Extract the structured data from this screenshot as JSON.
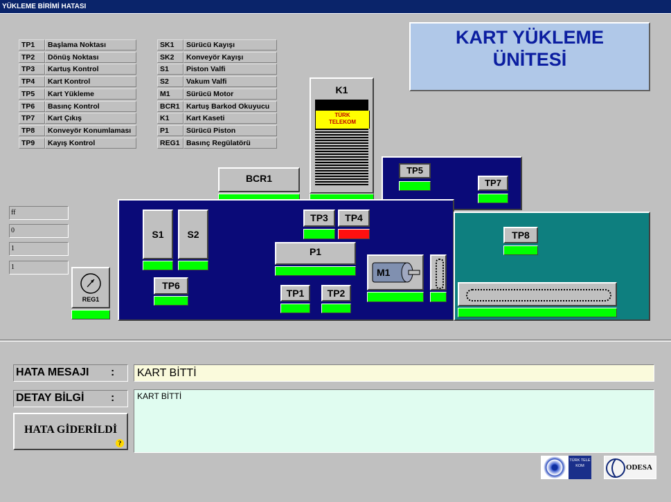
{
  "window_title": "YÜKLEME BİRİMİ HATASI",
  "header_title_line1": "KART YÜKLEME",
  "header_title_line2": "ÜNİTESİ",
  "legend_left": [
    {
      "code": "TP1",
      "desc": "Başlama Noktası"
    },
    {
      "code": "TP2",
      "desc": "Dönüş Noktası"
    },
    {
      "code": "TP3",
      "desc": "Kartuş Kontrol"
    },
    {
      "code": "TP4",
      "desc": "Kart Kontrol"
    },
    {
      "code": "TP5",
      "desc": "Kart Yükleme"
    },
    {
      "code": "TP6",
      "desc": "Basınç Kontrol"
    },
    {
      "code": "TP7",
      "desc": "Kart Çıkış"
    },
    {
      "code": "TP8",
      "desc": "Konveyör Konumlaması"
    },
    {
      "code": "TP9",
      "desc": "Kayış Kontrol"
    }
  ],
  "legend_right": [
    {
      "code": "SK1",
      "desc": "Sürücü Kayışı"
    },
    {
      "code": "SK2",
      "desc": "Konveyör Kayışı"
    },
    {
      "code": "S1",
      "desc": "Piston Valfi"
    },
    {
      "code": "S2",
      "desc": "Vakum Valfi"
    },
    {
      "code": "M1",
      "desc": "Sürücü Motor"
    },
    {
      "code": "BCR1",
      "desc": "Kartuş Barkod Okuyucu"
    },
    {
      "code": "K1",
      "desc": "Kart Kaseti"
    },
    {
      "code": "P1",
      "desc": "Sürücü Piston"
    },
    {
      "code": "REG1",
      "desc": "Basınç Regülatörü"
    }
  ],
  "side_fields": [
    "ff",
    "0",
    "1",
    "1"
  ],
  "components": {
    "k1": "K1",
    "card_brand_line1": "TÜRK",
    "card_brand_line2": "TELEKOM",
    "bcr1": "BCR1",
    "tp5": "TP5",
    "tp7": "TP7",
    "tp3": "TP3",
    "tp4": "TP4",
    "s1": "S1",
    "s2": "S2",
    "p1": "P1",
    "m1": "M1",
    "tp6": "TP6",
    "tp1": "TP1",
    "tp2": "TP2",
    "tp8": "TP8",
    "reg1": "REG1"
  },
  "status_colors": {
    "ok": "#00ff00",
    "error": "#ff1010"
  },
  "error": {
    "message_label": "HATA MESAJI",
    "message_colon": ":",
    "message_value": "KART BİTTİ",
    "detail_label": "DETAY BİLGİ",
    "detail_colon": ":",
    "detail_value": "KART BİTTİ",
    "resolve_button": "HATA GİDERİLDİ"
  },
  "logos": {
    "telekom_text": "TÜRK TELE KOM",
    "odesa_text": "ODESA"
  }
}
